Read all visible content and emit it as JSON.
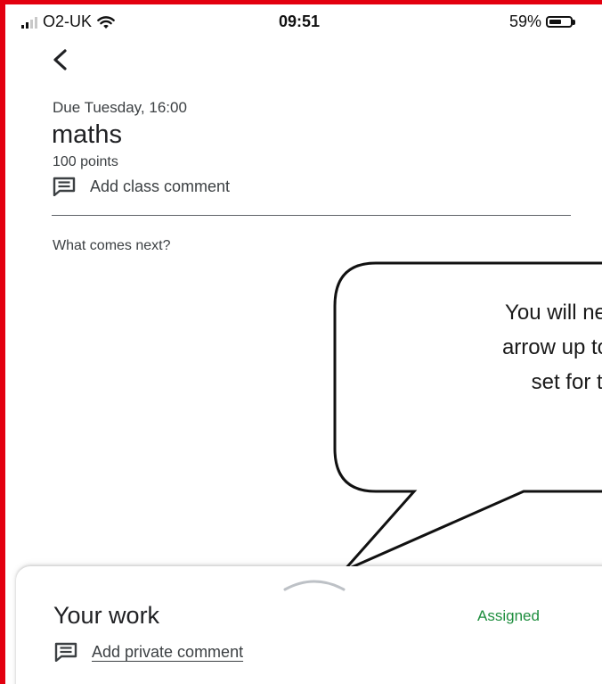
{
  "status_bar": {
    "carrier": "O2-UK",
    "time": "09:51",
    "battery": "59%",
    "battery_level": 0.59
  },
  "icons": {
    "back": "back-arrow-icon",
    "comment": "comment-icon",
    "wifi": "wifi-icon",
    "signal": "signal-icon",
    "battery": "battery-icon",
    "sheet_handle": "chevron-up-icon"
  },
  "assignment": {
    "due": "Due Tuesday, 16:00",
    "title": "maths",
    "points": "100 points",
    "class_comment_label": "Add class comment",
    "next_prompt": "What comes next?"
  },
  "callout": {
    "text": "You will need to s\narrow up to reveal\nset for the d"
  },
  "your_work": {
    "title": "Your work",
    "status": "Assigned",
    "private_comment_label": "Add private comment"
  },
  "colors": {
    "frame_border": "#e3000f",
    "status_assigned": "#1e8e3e"
  }
}
